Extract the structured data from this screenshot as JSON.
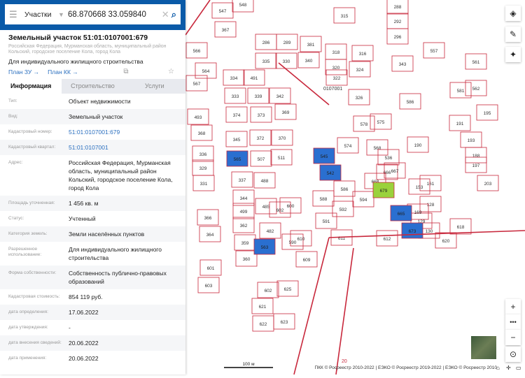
{
  "search": {
    "type": "Участки",
    "query": "68.870668 33.059840"
  },
  "header": {
    "title": "Земельный участок 51:01:0107001:679",
    "address": "Российская Федерация, Мурманская область, муниципальный район Кольский, городское поселение Кола, город Кола",
    "use": "Для индивидуального жилищного строительства",
    "links": [
      "План ЗУ →",
      "План КК →"
    ]
  },
  "tabs": [
    "Информация",
    "Строительство",
    "Услуги"
  ],
  "rows": [
    {
      "k": "Тип:",
      "v": "Объект недвижимости"
    },
    {
      "k": "Вид:",
      "v": "Земельный участок"
    },
    {
      "k": "Кадастровый номер:",
      "v": "51:01:0107001:679",
      "link": true
    },
    {
      "k": "Кадастровый квартал:",
      "v": "51:01:0107001",
      "link": true
    },
    {
      "k": "Адрес:",
      "v": "Российская Федерация, Мурманская область, муниципальный район Кольский, городское поселение Кола, город Кола"
    },
    {
      "k": "Площадь уточненная:",
      "v": "1 456 кв. м"
    },
    {
      "k": "Статус:",
      "v": "Учтенный"
    },
    {
      "k": "Категория земель:",
      "v": "Земли населённых пунктов"
    },
    {
      "k": "Разрешенное использование:",
      "v": "Для индивидуального жилищного строительства"
    },
    {
      "k": "Форма собственности:",
      "v": "Собственность публично-правовых образований"
    },
    {
      "k": "Кадастровая стоимость:",
      "v": "854 119 руб."
    },
    {
      "k": "дата определения:",
      "v": "17.06.2022"
    },
    {
      "k": "дата утверждения:",
      "v": "-"
    },
    {
      "k": "дата внесения сведений:",
      "v": "20.06.2022"
    },
    {
      "k": "дата применения:",
      "v": "20.06.2022"
    }
  ],
  "map": {
    "parcels": [
      "548",
      "547",
      "367",
      "566",
      "564",
      "567",
      "493",
      "368",
      "336",
      "329",
      "331",
      "366",
      "364",
      "601",
      "603",
      "334",
      "491",
      "333",
      "339",
      "342",
      "374",
      "373",
      "369",
      "345",
      "372",
      "370",
      "507",
      "511",
      "337",
      "488",
      "344",
      "499",
      "362",
      "359",
      "360",
      "485",
      "482",
      "286",
      "289",
      "330",
      "340",
      "335",
      "381",
      "320",
      "322",
      "324",
      "326",
      "318",
      "316",
      "315",
      "288",
      "292",
      "296",
      "343",
      "557",
      "561",
      "562",
      "581",
      "586",
      "578",
      "575",
      "574",
      "568",
      "536",
      "190",
      "666",
      "667",
      "668",
      "586",
      "588",
      "592",
      "594",
      "591",
      "611",
      "612",
      "620",
      "618",
      "161",
      "128",
      "130",
      "129",
      "169",
      "153",
      "203",
      "188",
      "191",
      "195",
      "197",
      "193",
      "600",
      "602",
      "590",
      "609",
      "610",
      "602",
      "621",
      "622",
      "623",
      "625"
    ],
    "highlighted": [
      "565",
      "545",
      "542",
      "563",
      "665",
      "673"
    ],
    "selected": "679",
    "quarter_label": "0107001",
    "road_label": "20",
    "scale": "100 м",
    "attribution": "ПКК © Росреестр 2010-2022 | ЕЭКО © Росреестр 2019-2022 | ЕЭКО © Росреестр 2010",
    "colors": {
      "parcel": "#c8283c",
      "highlight": "#2a6fd0",
      "selected": "#9ad23c"
    }
  }
}
